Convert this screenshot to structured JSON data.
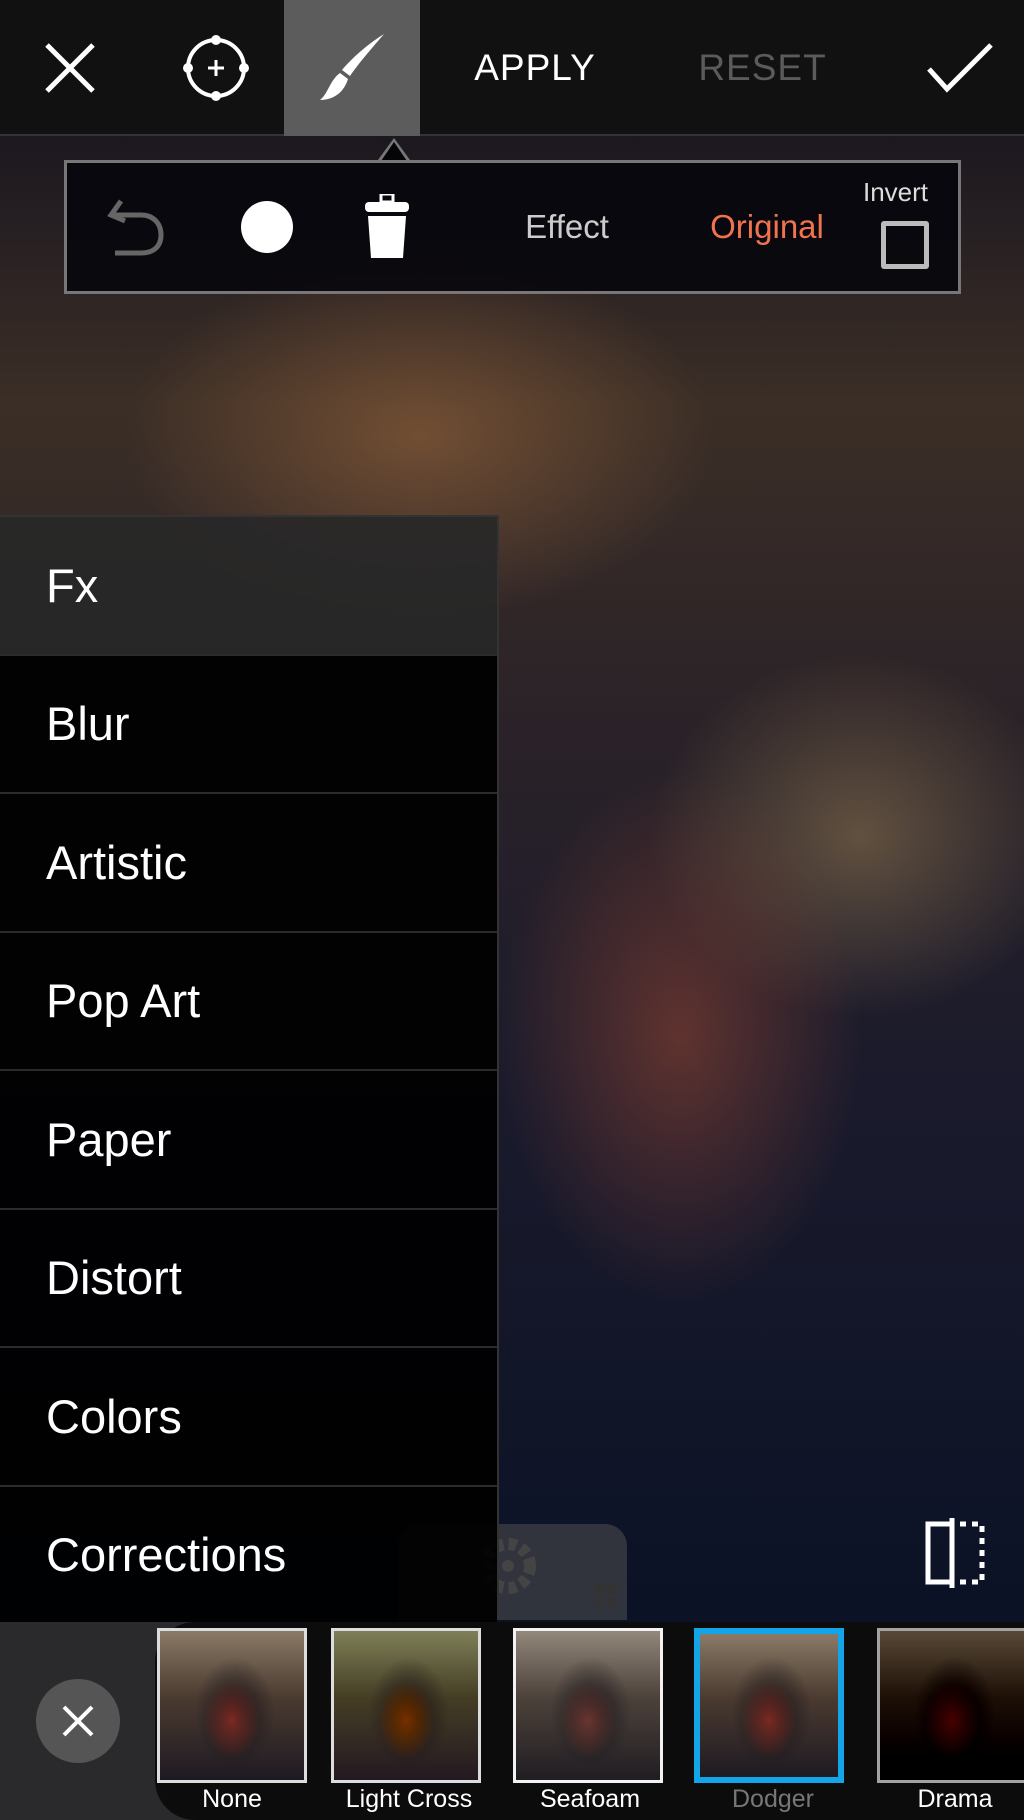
{
  "toolbar": {
    "close_icon": "close-icon",
    "target_icon": "crosshair-target-icon",
    "brush_icon": "brush-icon",
    "apply_label": "APPLY",
    "reset_label": "RESET",
    "confirm_icon": "check-icon"
  },
  "brush_panel": {
    "undo_icon": "undo-icon",
    "brush_size_icon": "circle-icon",
    "delete_icon": "trash-icon",
    "effect_label": "Effect",
    "original_label": "Original",
    "invert_label": "Invert",
    "invert_checked": false,
    "active_color": "#f0734d"
  },
  "menu": {
    "items": [
      "Fx",
      "Blur",
      "Artistic",
      "Pop Art",
      "Paper",
      "Distort",
      "Colors",
      "Corrections"
    ],
    "selected": "Fx"
  },
  "filters": {
    "items": [
      "None",
      "Light Cross",
      "Seafoam",
      "Dodger",
      "Drama"
    ],
    "selected": "Dodger",
    "selected_color": "#13a5e8"
  },
  "overlay": {
    "settings_icon": "gear-icon",
    "compare_icon": "compare-split-icon",
    "close_icon": "close-icon"
  }
}
